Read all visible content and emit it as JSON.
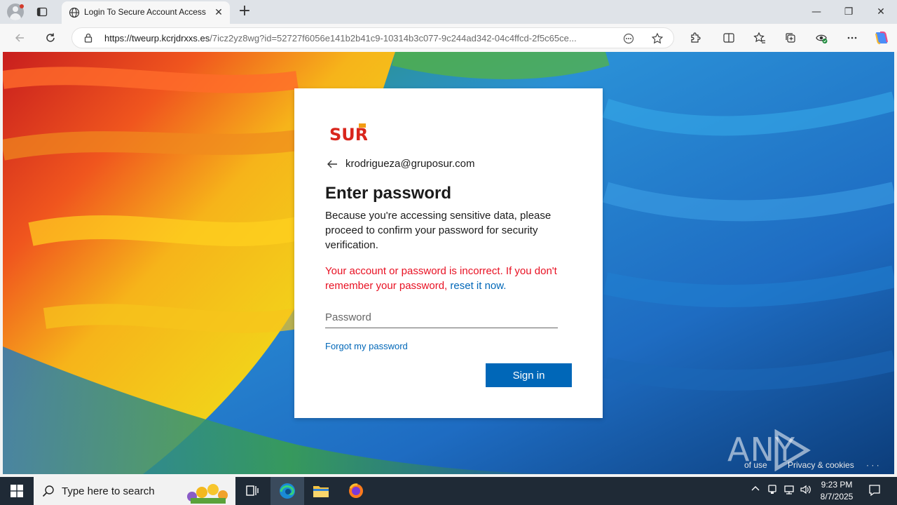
{
  "browser": {
    "tab_title": "Login To Secure Account Access",
    "new_tab_symbol": "+",
    "close_tab_symbol": "✕",
    "url_host": "https://tweurp.kcrjdrxxs.es",
    "url_path": "/7icz2yz8wg?id=52727f6056e141b2b41c9-10314b3c077-9c244ad342-04c4ffcd-2f5c65ce...",
    "window_controls": {
      "minimize": "—",
      "restore": "❐",
      "close": "✕"
    }
  },
  "login": {
    "brand": "SUR",
    "identity": "krodrigueza@gruposur.com",
    "heading": "Enter password",
    "description": "Because you're accessing sensitive data, please proceed to confirm your password for security verification.",
    "error_text": "Your account or password is incorrect. If you don't remember your password, ",
    "error_link": "reset it now.",
    "password_placeholder": "Password",
    "forgot_link": "Forgot my password",
    "signin_label": "Sign in",
    "accent_color": "#0067b8",
    "error_color": "#e81123"
  },
  "page_footer": {
    "terms": "of use",
    "privacy": "Privacy & cookies",
    "more": "· · ·"
  },
  "watermark": {
    "left": "ANY",
    "right": "RUN"
  },
  "taskbar": {
    "search_placeholder": "Type here to search",
    "time": "9:23 PM",
    "date": "8/7/2025"
  }
}
